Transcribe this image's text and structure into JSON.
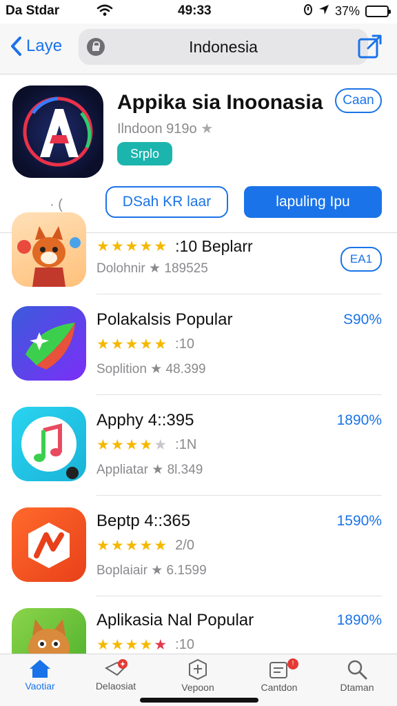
{
  "status_bar": {
    "carrier": "Da Stdar",
    "time": "49:33",
    "battery": "37%",
    "battery_level": 0.37
  },
  "nav": {
    "back_label": "Laye",
    "url_text": "Indonesia"
  },
  "featured": {
    "title": "Appika sia Inoonasia",
    "subtitle": "Ilndoon 919o",
    "tag": "Srplo",
    "get_label": "Caan",
    "marks": "·  (",
    "button_outline": "DSah KR laar",
    "button_fill": "lapuling Ipu",
    "accent_color": "#1a73e8"
  },
  "apps": [
    {
      "name": "",
      "rating_text": ":10 Beplarr",
      "stars": "5",
      "meta": "Dolohnir",
      "meta_count": "189525",
      "price": "",
      "action": "EA1"
    },
    {
      "name": "Polakalsis Popular",
      "rating_text": ":10",
      "stars": "4.5",
      "meta": "Soplition",
      "meta_count": "48.399",
      "price": "S90%",
      "action": ""
    },
    {
      "name": "Apphy 4::395",
      "rating_text": ":1N",
      "stars": "4",
      "meta": "Appliatar",
      "meta_count": "8l.349",
      "price": "1890%",
      "action": ""
    },
    {
      "name": "Beptp 4::365",
      "rating_text": "2/0",
      "stars": "4.5",
      "meta": "Boplaiair",
      "meta_count": "6.1599",
      "price": "1590%",
      "action": ""
    },
    {
      "name": "Aplikasia Nal Popular",
      "rating_text": ":10",
      "stars": "4",
      "meta": "",
      "meta_count": "",
      "price": "1890%",
      "action": ""
    }
  ],
  "tabs": [
    {
      "label": "Vaotiar",
      "icon": "home-icon"
    },
    {
      "label": "Delaosiat",
      "icon": "games-icon"
    },
    {
      "label": "Vepoon",
      "icon": "apps-icon"
    },
    {
      "label": "Cantdon",
      "icon": "updates-icon"
    },
    {
      "label": "Dtaman",
      "icon": "search-icon"
    }
  ]
}
